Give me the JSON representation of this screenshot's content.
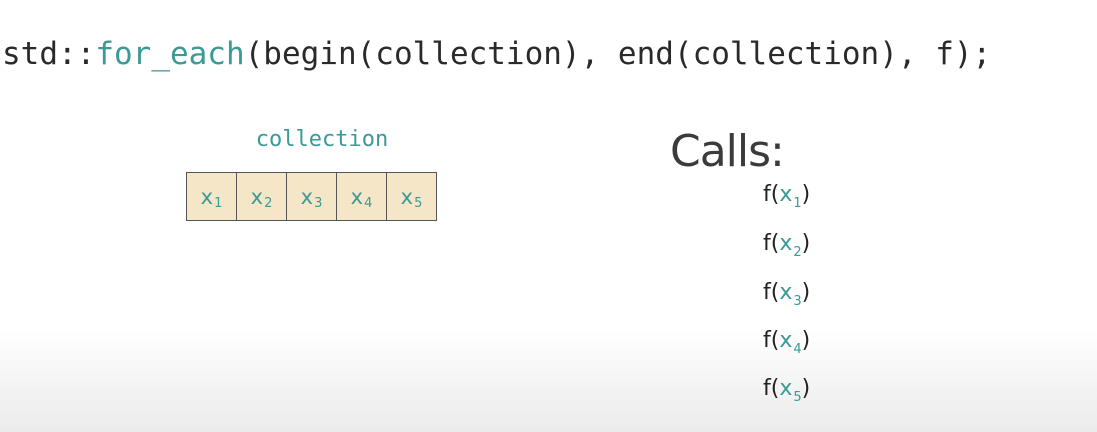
{
  "code": {
    "prefix": "std::",
    "function": "for_each",
    "args": "(begin(collection), end(collection), f);"
  },
  "collection": {
    "label": "collection",
    "cells": [
      {
        "var": "x",
        "sub": "1"
      },
      {
        "var": "x",
        "sub": "2"
      },
      {
        "var": "x",
        "sub": "3"
      },
      {
        "var": "x",
        "sub": "4"
      },
      {
        "var": "x",
        "sub": "5"
      }
    ]
  },
  "calls": {
    "title": "Calls:",
    "items": [
      {
        "fn": "f(",
        "var": "x",
        "sub": "1",
        "close": ")"
      },
      {
        "fn": "f(",
        "var": "x",
        "sub": "2",
        "close": ")"
      },
      {
        "fn": "f(",
        "var": "x",
        "sub": "3",
        "close": ")"
      },
      {
        "fn": "f(",
        "var": "x",
        "sub": "4",
        "close": ")"
      },
      {
        "fn": "f(",
        "var": "x",
        "sub": "5",
        "close": ")"
      }
    ]
  },
  "colors": {
    "accent": "#3a9a96",
    "cell_fill": "#f6e6c8",
    "text": "#2a2a2a"
  }
}
